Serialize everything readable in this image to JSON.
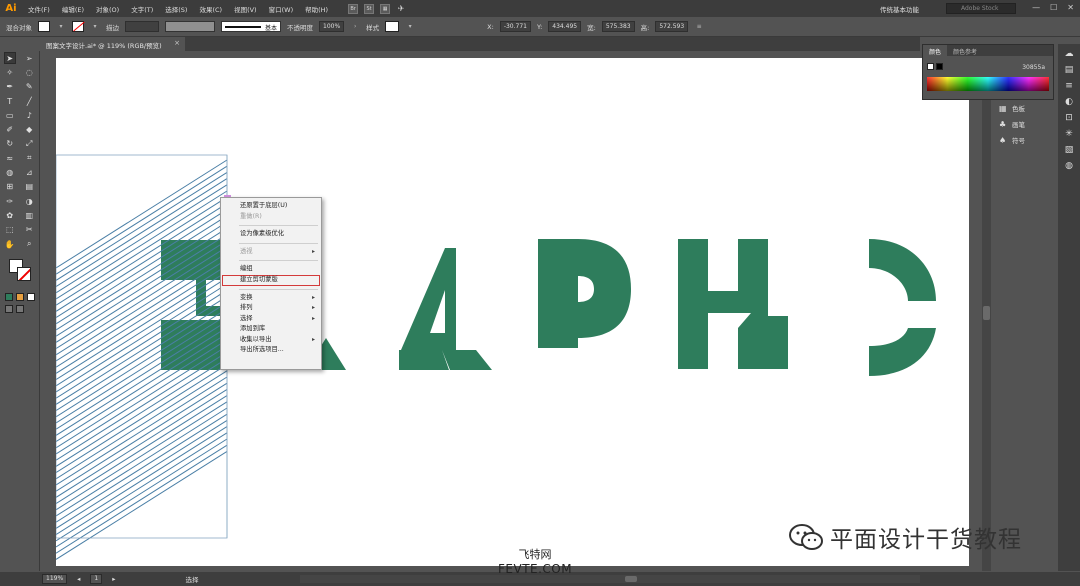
{
  "app": {
    "logo": "Ai",
    "menus": [
      "文件(F)",
      "编辑(E)",
      "对象(O)",
      "文字(T)",
      "选择(S)",
      "效果(C)",
      "视图(V)",
      "窗口(W)",
      "帮助(H)"
    ],
    "menubar_icons": [
      "Br",
      "St"
    ],
    "workspace": "传统基本功能",
    "search_placeholder": "Adobe Stock",
    "window_controls": [
      "—",
      "☐",
      "✕"
    ]
  },
  "controlbar": {
    "selection_label": "混合对象",
    "stroke_label": "描边",
    "stroke_style": "基本",
    "opacity_label": "不透明度",
    "opacity_value": "100%",
    "style_label": "样式",
    "x_value": "-30.771",
    "y_value": "434.495",
    "w_value": "575.383",
    "h_value": "572.593"
  },
  "document": {
    "tab_title": "图案文字设计.ai* @ 119% (RGB/预览)",
    "zoom": "119%",
    "page": "1",
    "status_tool": "选择"
  },
  "color_panel": {
    "tabs": [
      "颜色",
      "颜色参考"
    ],
    "hex": "30855a",
    "colors": {
      "fill": "#ffffff",
      "stroke": "none",
      "letters": "#2e7d5c",
      "lines": "#4a7fa6"
    }
  },
  "right_panels": {
    "items": [
      {
        "label": "色板",
        "icon": "swatches-icon"
      },
      {
        "label": "画笔",
        "icon": "brush-icon"
      },
      {
        "label": "符号",
        "icon": "symbol-icon"
      }
    ]
  },
  "context_menu": {
    "items": [
      {
        "label": "还原置于底层(U)",
        "disabled": false,
        "submenu": false
      },
      {
        "label": "重做(R)",
        "disabled": true,
        "submenu": false
      },
      {
        "sep": true
      },
      {
        "label": "设为像素级优化",
        "disabled": false,
        "submenu": false
      },
      {
        "sep": true
      },
      {
        "label": "透视",
        "disabled": true,
        "submenu": true
      },
      {
        "sep": true
      },
      {
        "label": "编组",
        "disabled": false,
        "submenu": false
      },
      {
        "label": "建立剪切蒙版",
        "disabled": false,
        "submenu": false,
        "highlight": true
      },
      {
        "sep": true
      },
      {
        "label": "变换",
        "disabled": false,
        "submenu": true
      },
      {
        "label": "排列",
        "disabled": false,
        "submenu": true
      },
      {
        "label": "选择",
        "disabled": false,
        "submenu": true
      },
      {
        "label": "添加到库",
        "disabled": false,
        "submenu": false
      },
      {
        "label": "收集以导出",
        "disabled": false,
        "submenu": true
      },
      {
        "label": "导出所选项目...",
        "disabled": false,
        "submenu": false
      }
    ]
  },
  "watermark": {
    "text": "平面设计干货教程",
    "site_cn": "飞特网",
    "site_en": "FEVTE.COM"
  }
}
